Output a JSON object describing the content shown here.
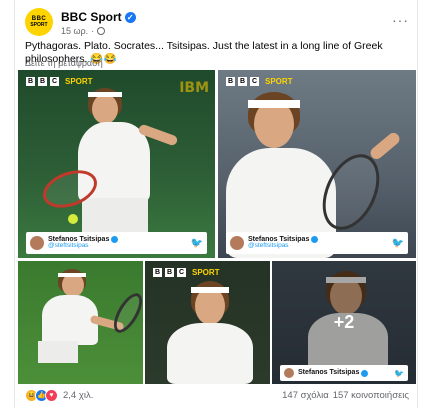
{
  "post": {
    "page_name": "BBC Sport",
    "avatar_line1": "BBC",
    "avatar_line2": "SPORT",
    "time": "15 ωρ.",
    "dot": "·",
    "text": "Pythagoras. Plato. Socrates... Tsitsipas. Just the latest in a long line of Greek philosophers. 😂😂",
    "translate": "Δείτε τη μετάφραση"
  },
  "gallery": {
    "brand_letters": [
      "B",
      "B",
      "C"
    ],
    "brand_sport": "SPORT",
    "sponsor": "IBM",
    "tag_name": "Stefanos Tsitsipas",
    "tag_handle": "@steftsitsipas",
    "more_count": "+2"
  },
  "footer": {
    "reactions_count": "2,4 χιλ.",
    "comments": "147 σχόλια",
    "shares": "157 κοινοποιήσεις"
  },
  "colors": {
    "brand_yellow": "#fdd400",
    "facebook_blue": "#1877f2",
    "twitter_blue": "#1d9bf0"
  }
}
